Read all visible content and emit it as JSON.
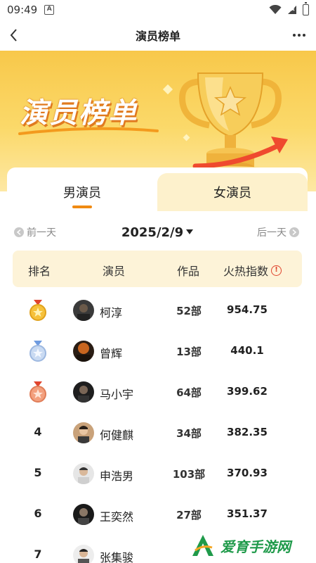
{
  "status_bar": {
    "time": "09:49",
    "notification_glyph": "A"
  },
  "nav": {
    "title": "演员榜单"
  },
  "banner": {
    "title": "演员榜单"
  },
  "tabs": [
    {
      "label": "男演员",
      "active": true
    },
    {
      "label": "女演员",
      "active": false
    }
  ],
  "date_row": {
    "prev_label": "前一天",
    "current_date": "2025/2/9",
    "next_label": "后一天"
  },
  "table": {
    "headers": {
      "rank": "排名",
      "actor": "演员",
      "works": "作品",
      "heat": "火热指数"
    },
    "rows": [
      {
        "rank": "1",
        "name": "柯淳",
        "works": "52部",
        "heat": "954.75"
      },
      {
        "rank": "2",
        "name": "曾辉",
        "works": "13部",
        "heat": "440.1"
      },
      {
        "rank": "3",
        "name": "马小宇",
        "works": "64部",
        "heat": "399.62"
      },
      {
        "rank": "4",
        "name": "何健麒",
        "works": "34部",
        "heat": "382.35"
      },
      {
        "rank": "5",
        "name": "申浩男",
        "works": "103部",
        "heat": "370.93"
      },
      {
        "rank": "6",
        "name": "王奕然",
        "works": "27部",
        "heat": "351.37"
      },
      {
        "rank": "7",
        "name": "张集骏",
        "works": "",
        "heat": ""
      }
    ]
  },
  "watermark": {
    "text": "爱育手游网"
  },
  "colors": {
    "accent": "#f08a12",
    "banner": "#f8c84a",
    "header_bg": "#fdf3d8",
    "watermark": "#1f9a4a"
  }
}
